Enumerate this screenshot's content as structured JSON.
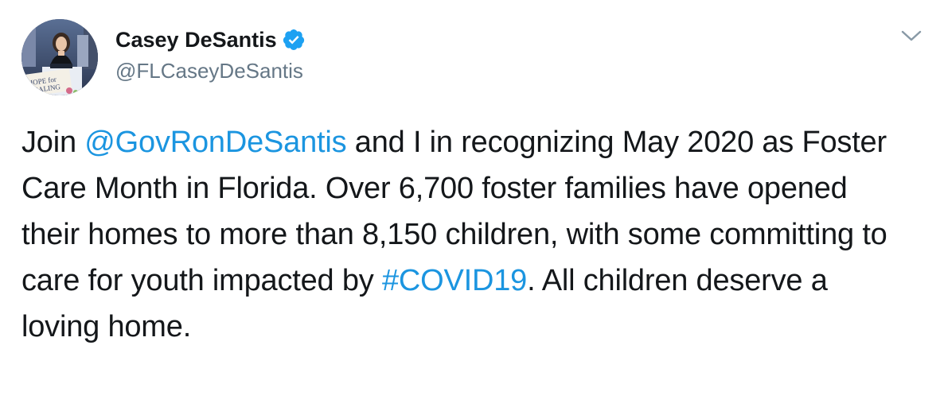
{
  "tweet": {
    "author": {
      "name": "Casey DeSantis",
      "handle": "@FLCaseyDeSantis",
      "verified": true,
      "avatar_sign_text": [
        "HOPE for",
        "HEALING"
      ]
    },
    "menu_icon": "chevron-down-icon",
    "text": {
      "part1": "Join ",
      "mention": "@GovRonDeSantis",
      "part2": " and I in recognizing May 2020 as Foster Care Month in Florida. Over 6,700 foster families have opened their homes to more than 8,150 children, with some committing to care for youth impacted by ",
      "hashtag": "#COVID19",
      "part3": ". All children deserve a loving home."
    }
  },
  "colors": {
    "text": "#14171a",
    "secondary": "#657786",
    "link": "#1b95e0",
    "verified_badge": "#1da1f2",
    "caret": "#8899a6"
  }
}
